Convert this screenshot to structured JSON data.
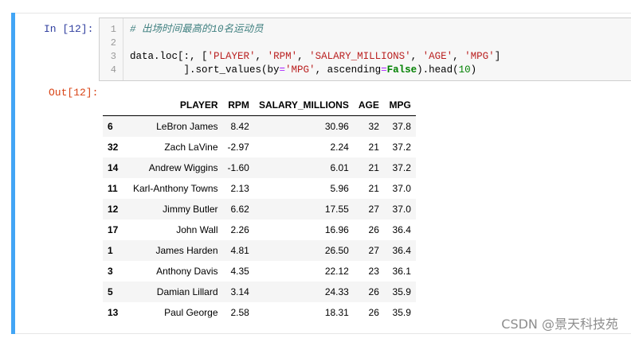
{
  "cell": {
    "in_prompt": "In  [12]:",
    "out_prompt": "Out[12]:"
  },
  "code_lines": [
    {
      "num": "1",
      "text": "# 出场时间最高的10名运动员"
    },
    {
      "num": "2",
      "text": ""
    },
    {
      "num": "3",
      "text": "data.loc[:, ['PLAYER', 'RPM', 'SALARY_MILLIONS', 'AGE', 'MPG']"
    },
    {
      "num": "4",
      "text": "         ].sort_values(by='MPG', ascending=False).head(10)"
    }
  ],
  "table": {
    "columns": [
      "",
      "PLAYER",
      "RPM",
      "SALARY_MILLIONS",
      "AGE",
      "MPG"
    ],
    "rows": [
      {
        "index": "6",
        "player": "LeBron James",
        "rpm": "8.42",
        "salary": "30.96",
        "age": "32",
        "mpg": "37.8"
      },
      {
        "index": "32",
        "player": "Zach LaVine",
        "rpm": "-2.97",
        "salary": "2.24",
        "age": "21",
        "mpg": "37.2"
      },
      {
        "index": "14",
        "player": "Andrew Wiggins",
        "rpm": "-1.60",
        "salary": "6.01",
        "age": "21",
        "mpg": "37.2"
      },
      {
        "index": "11",
        "player": "Karl-Anthony Towns",
        "rpm": "2.13",
        "salary": "5.96",
        "age": "21",
        "mpg": "37.0"
      },
      {
        "index": "12",
        "player": "Jimmy Butler",
        "rpm": "6.62",
        "salary": "17.55",
        "age": "27",
        "mpg": "37.0"
      },
      {
        "index": "17",
        "player": "John Wall",
        "rpm": "2.26",
        "salary": "16.96",
        "age": "26",
        "mpg": "36.4"
      },
      {
        "index": "1",
        "player": "James Harden",
        "rpm": "4.81",
        "salary": "26.50",
        "age": "27",
        "mpg": "36.4"
      },
      {
        "index": "3",
        "player": "Anthony Davis",
        "rpm": "4.35",
        "salary": "22.12",
        "age": "23",
        "mpg": "36.1"
      },
      {
        "index": "5",
        "player": "Damian Lillard",
        "rpm": "3.14",
        "salary": "24.33",
        "age": "26",
        "mpg": "35.9"
      },
      {
        "index": "13",
        "player": "Paul George",
        "rpm": "2.58",
        "salary": "18.31",
        "age": "26",
        "mpg": "35.9"
      }
    ]
  },
  "watermark": "CSDN @景天科技苑",
  "colors": {
    "selection_bar": "#42a5f5",
    "in_prompt": "#303f9f",
    "out_prompt": "#d84315"
  }
}
